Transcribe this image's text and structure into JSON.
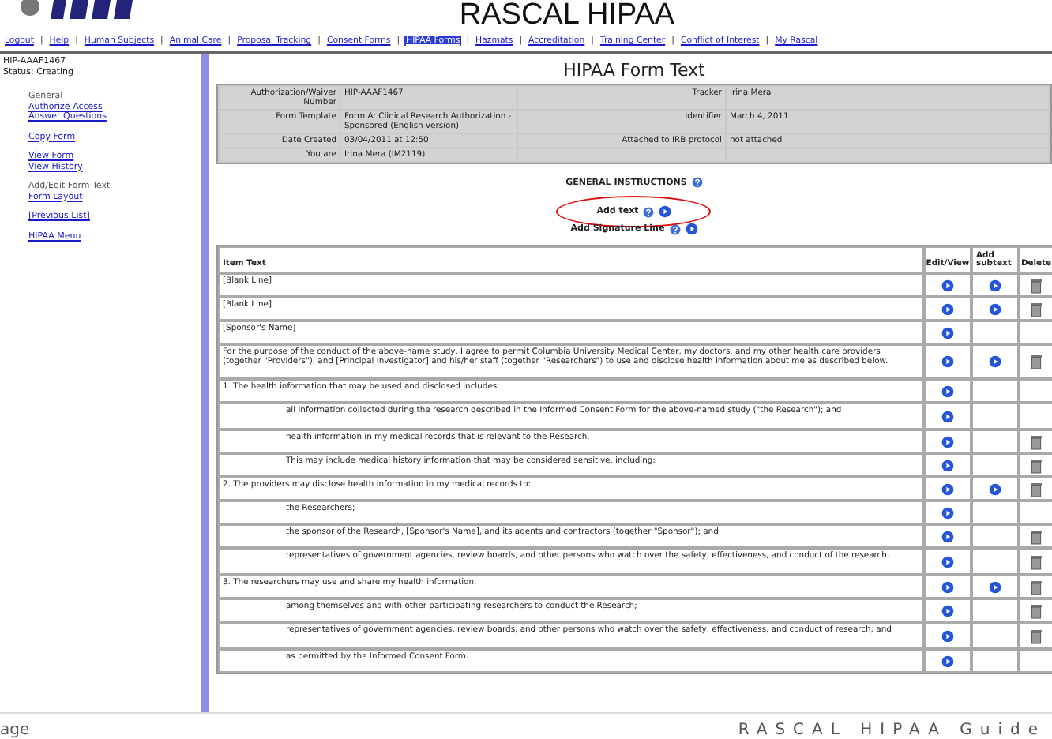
{
  "header": {
    "title": "RASCAL HIPAA"
  },
  "nav": [
    {
      "kind": "link",
      "label": "Logout",
      "selected": false
    },
    {
      "kind": "separator",
      "label": "|"
    },
    {
      "kind": "link",
      "label": "Help",
      "selected": false
    },
    {
      "kind": "separator",
      "label": "|"
    },
    {
      "kind": "link",
      "label": "Human Subjects",
      "selected": false
    },
    {
      "kind": "separator",
      "label": "|"
    },
    {
      "kind": "link",
      "label": "Animal Care",
      "selected": false
    },
    {
      "kind": "separator",
      "label": "|"
    },
    {
      "kind": "link",
      "label": "Proposal Tracking",
      "selected": false
    },
    {
      "kind": "separator",
      "label": "|"
    },
    {
      "kind": "link",
      "label": "Consent Forms",
      "selected": false
    },
    {
      "kind": "separator",
      "label": "|"
    },
    {
      "kind": "link",
      "label": "HIPAA Forms",
      "selected": true
    },
    {
      "kind": "separator",
      "label": "|"
    },
    {
      "kind": "link",
      "label": "Hazmats",
      "selected": false
    },
    {
      "kind": "separator",
      "label": "|"
    },
    {
      "kind": "link",
      "label": "Accreditation",
      "selected": false
    },
    {
      "kind": "separator",
      "label": "|"
    },
    {
      "kind": "link",
      "label": "Training Center",
      "selected": false
    },
    {
      "kind": "separator",
      "label": "|"
    },
    {
      "kind": "link",
      "label": "Conflict of Interest",
      "selected": false
    },
    {
      "kind": "separator",
      "label": "|"
    },
    {
      "kind": "link",
      "label": "My Rascal",
      "selected": false
    }
  ],
  "sidebar": {
    "record": "HIP-AAAF1467",
    "status": "Status: Creating",
    "groups": [
      [
        {
          "label": "General",
          "link": false
        },
        {
          "label": "Authorize Access",
          "link": true
        },
        {
          "label": "Answer Questions",
          "link": true
        }
      ],
      [
        {
          "label": "Copy Form",
          "link": true
        }
      ],
      [
        {
          "label": "View Form",
          "link": true
        },
        {
          "label": "View History",
          "link": true
        }
      ],
      [
        {
          "label": "Add/Edit Form Text",
          "link": false
        },
        {
          "label": "Form Layout",
          "link": true
        }
      ],
      [
        {
          "label": "[Previous List]",
          "link": true
        }
      ],
      [
        {
          "label": "HIPAA Menu",
          "link": true
        }
      ]
    ]
  },
  "main": {
    "title": "HIPAA Form Text",
    "info": [
      {
        "label": "Authorization/Waiver Number",
        "value": "HIP-AAAF1467",
        "label_2": "Tracker",
        "value_2": "Irina Mera"
      },
      {
        "label": "Form Template",
        "value": "Form A: Clinical Research Authorization - Sponsored (English version)",
        "label_2": "Identifier",
        "value_2": "March 4, 2011"
      },
      {
        "label": "Date Created",
        "value": "03/04/2011 at 12:50",
        "label_2": "Attached to IRB protocol",
        "value_2": "not attached"
      },
      {
        "label": "You are",
        "value": "Irina Mera (IM2119)"
      }
    ],
    "actions": [
      {
        "label": "GENERAL INSTRUCTIONS",
        "add": false,
        "highlighted": false
      },
      {
        "label": "Add text",
        "add": true,
        "highlighted": true
      },
      {
        "label": "Add Signature Line",
        "add": true,
        "highlighted": false
      }
    ],
    "table": {
      "columns": [
        "Item Text",
        "Edit/View",
        "Add subtext",
        "Delete"
      ],
      "rows": [
        {
          "text": "[Blank Line]",
          "indent": false,
          "edit": true,
          "subtext": true,
          "delete": true
        },
        {
          "text": "[Blank Line]",
          "indent": false,
          "edit": true,
          "subtext": true,
          "delete": true
        },
        {
          "text": "[Sponsor's Name]",
          "indent": false,
          "edit": true,
          "subtext": false,
          "delete": false
        },
        {
          "text": "For the purpose of the conduct of the above-name study, I agree to permit Columbia University Medical Center, my doctors, and my other health care providers (together \"Providers\"), and [Principal Investigator] and his/her staff (together \"Researchers\") to use and disclose health information about me as described below.",
          "indent": false,
          "edit": true,
          "subtext": true,
          "delete": true
        },
        {
          "text": "1. The health information that may be used and disclosed includes:",
          "indent": false,
          "edit": true,
          "subtext": false,
          "delete": false
        },
        {
          "text": "all information collected during the research described in the Informed Consent Form for the above-named study (\"the Research\"); and",
          "indent": true,
          "edit": true,
          "subtext": false,
          "delete": false
        },
        {
          "text": "health information in my medical records that is relevant to the Research.",
          "indent": true,
          "edit": true,
          "subtext": false,
          "delete": true
        },
        {
          "text": "This may include medical history information that may be considered sensitive, including:",
          "indent": true,
          "edit": true,
          "subtext": false,
          "delete": true
        },
        {
          "text": "2. The providers may disclose health information in my medical records to:",
          "indent": false,
          "edit": true,
          "subtext": true,
          "delete": true
        },
        {
          "text": "the Researchers;",
          "indent": true,
          "edit": true,
          "subtext": false,
          "delete": false
        },
        {
          "text": "the sponsor of the Research, [Sponsor's Name], and its agents and contractors (together \"Sponsor\"); and",
          "indent": true,
          "edit": true,
          "subtext": false,
          "delete": true
        },
        {
          "text": "representatives of government agencies, review boards, and other persons who watch over the safety, effectiveness, and conduct of the research.",
          "indent": true,
          "edit": true,
          "subtext": false,
          "delete": true
        },
        {
          "text": "3. The researchers may use and share my health information:",
          "indent": false,
          "edit": true,
          "subtext": true,
          "delete": true
        },
        {
          "text": "among themselves and with other participating researchers to conduct the Research;",
          "indent": true,
          "edit": true,
          "subtext": false,
          "delete": true
        },
        {
          "text": "representatives of government agencies, review boards, and other persons who watch over the safety, effectiveness, and conduct of research; and",
          "indent": true,
          "edit": true,
          "subtext": false,
          "delete": true
        },
        {
          "text": "as permitted by the Informed Consent Form.",
          "indent": true,
          "edit": true,
          "subtext": false,
          "delete": false
        }
      ]
    }
  },
  "footer": {
    "page": "age",
    "guide": "RASCAL HIPAA Guide"
  }
}
